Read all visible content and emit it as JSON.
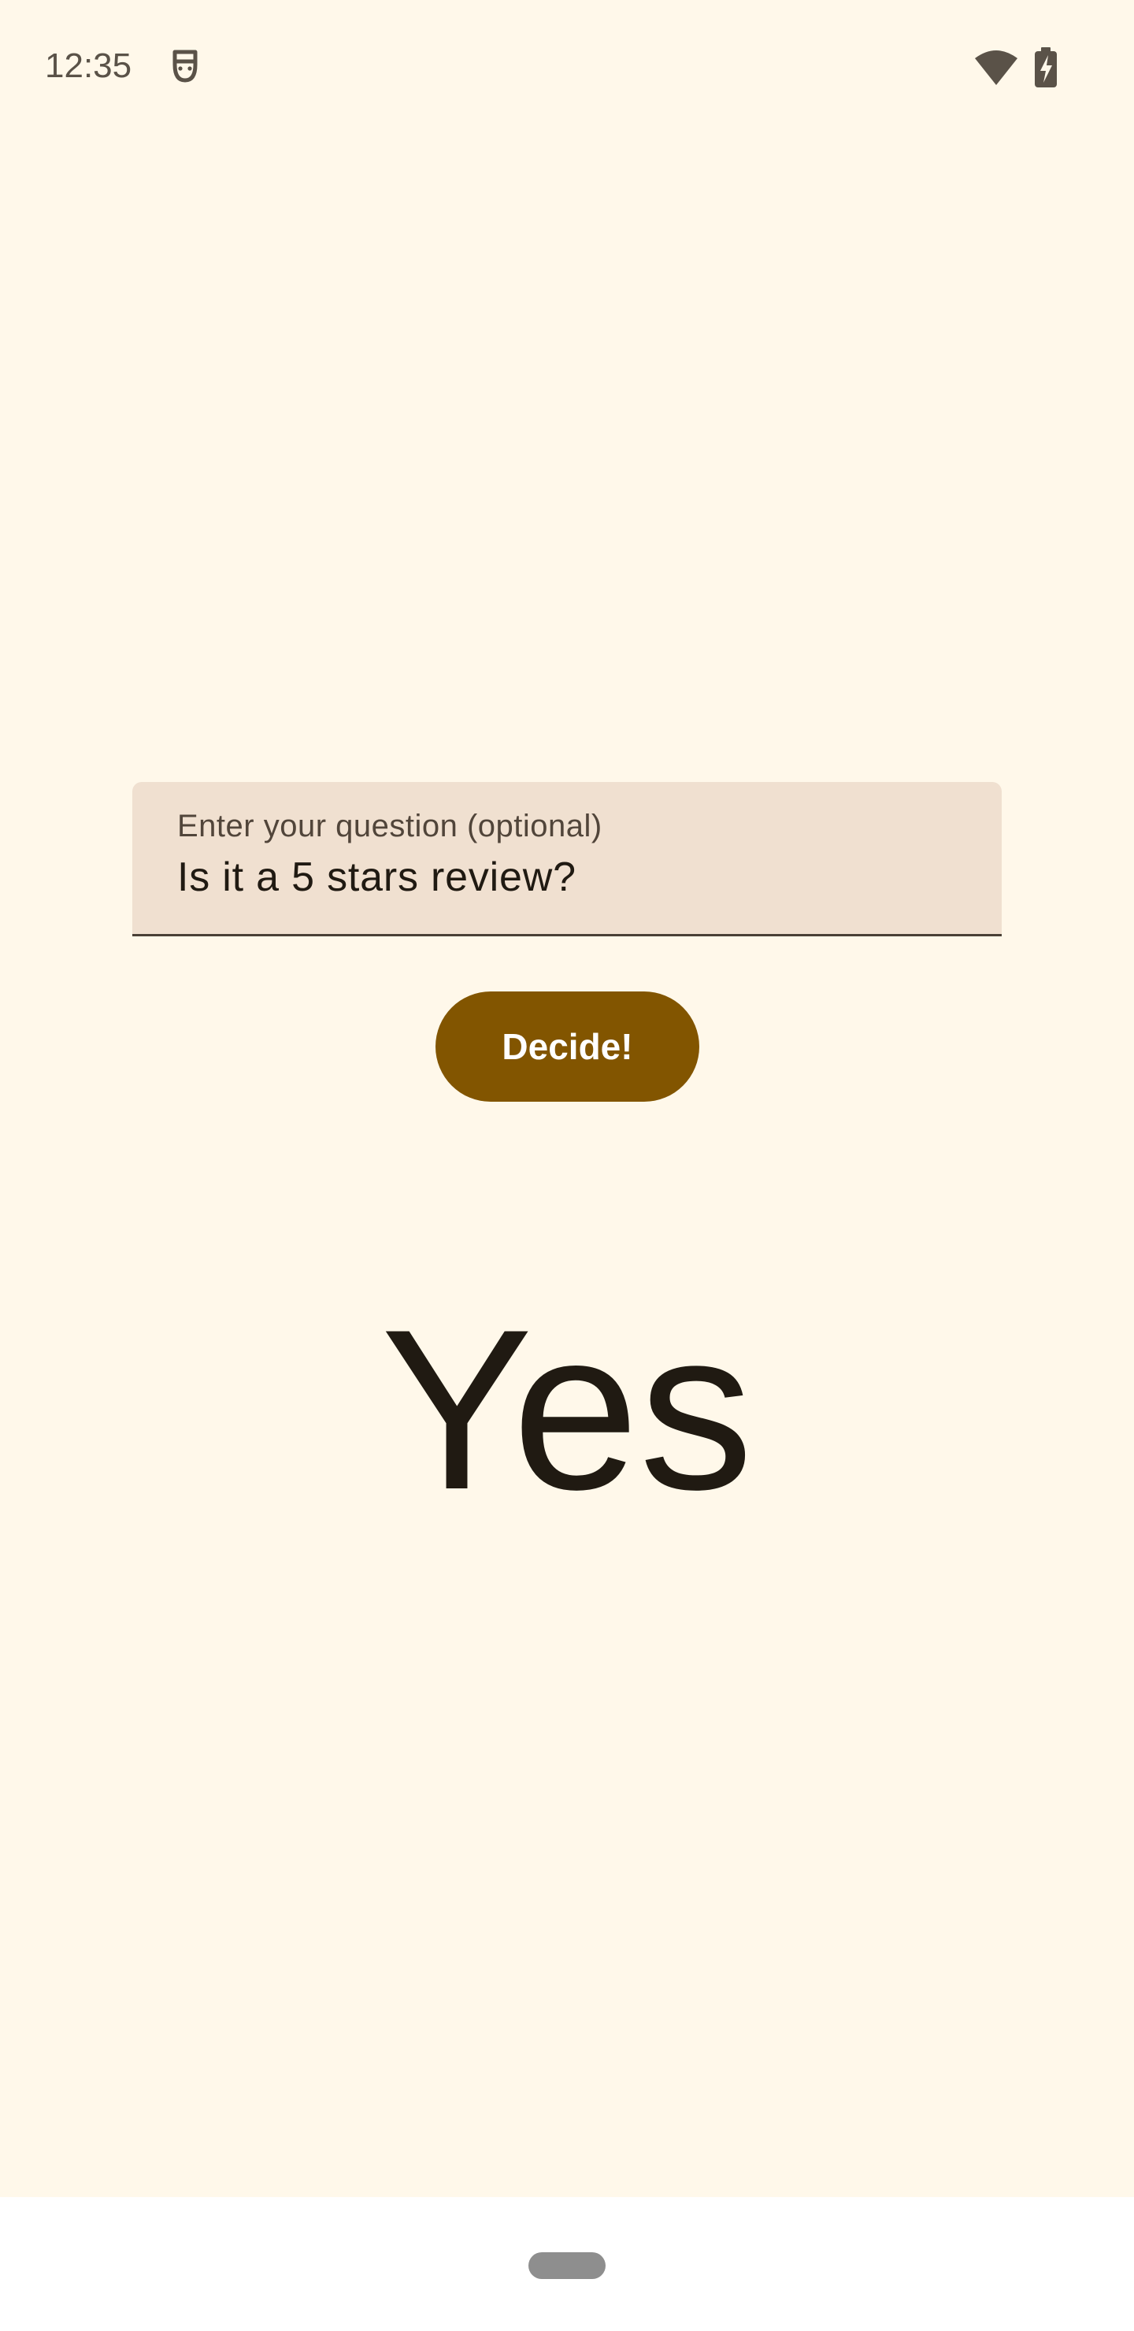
{
  "status_bar": {
    "time": "12:35",
    "icons": [
      "debug-icon",
      "wifi-icon",
      "battery-charging-icon"
    ]
  },
  "question_field": {
    "label": "Enter your question (optional)",
    "value": "Is it a 5 stars review?"
  },
  "decide_button": {
    "label": "Decide!"
  },
  "answer": {
    "text": "Yes"
  },
  "colors": {
    "background": "#FFF8EA",
    "field_background": "#F0E0D0",
    "button_background": "#825500",
    "button_text": "#FFFFFF",
    "text_primary": "#201A12",
    "navigation_bar": "#FFFFFF",
    "nav_handle": "#8E8E8E"
  }
}
